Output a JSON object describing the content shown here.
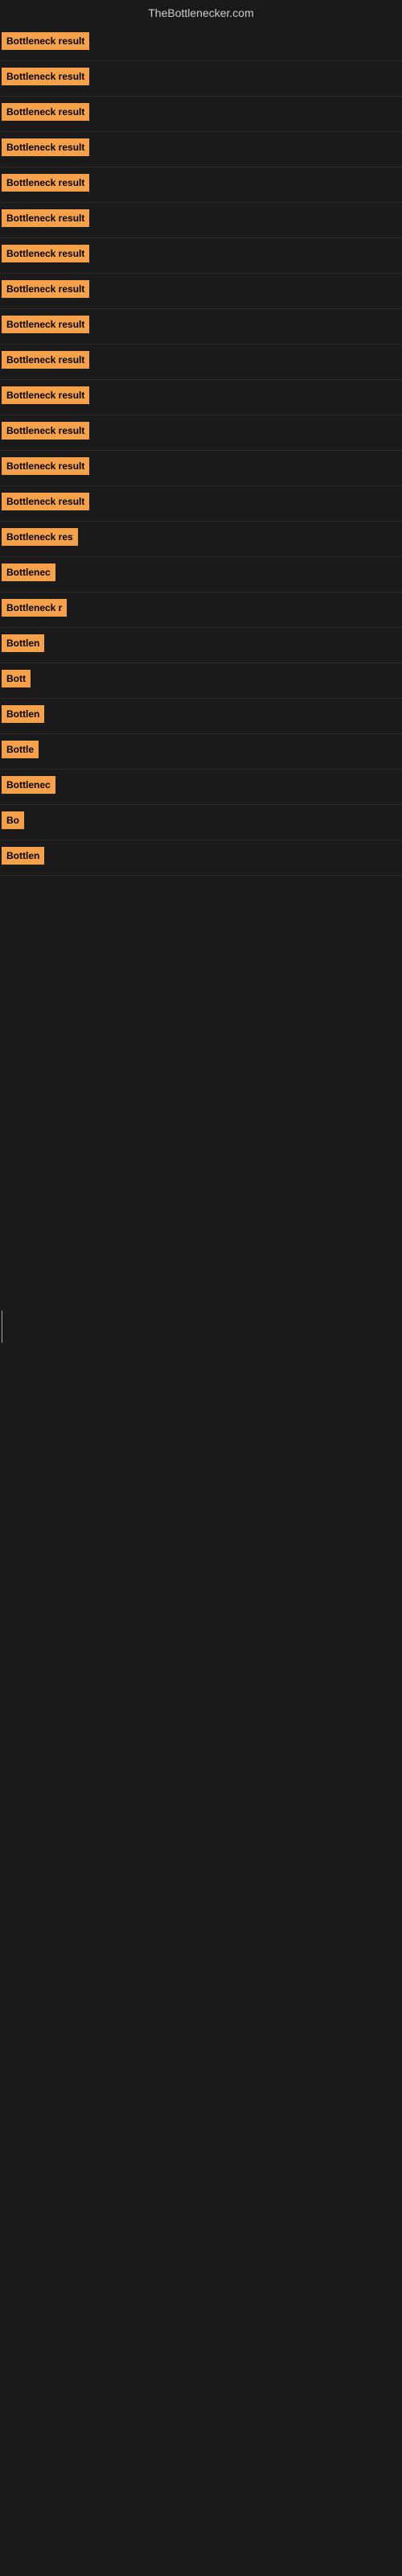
{
  "site": {
    "title": "TheBottlenecker.com"
  },
  "rows": [
    {
      "label": "Bottleneck result",
      "width": 120
    },
    {
      "label": "Bottleneck result",
      "width": 120
    },
    {
      "label": "Bottleneck result",
      "width": 120
    },
    {
      "label": "Bottleneck result",
      "width": 120
    },
    {
      "label": "Bottleneck result",
      "width": 120
    },
    {
      "label": "Bottleneck result",
      "width": 120
    },
    {
      "label": "Bottleneck result",
      "width": 120
    },
    {
      "label": "Bottleneck result",
      "width": 120
    },
    {
      "label": "Bottleneck result",
      "width": 120
    },
    {
      "label": "Bottleneck result",
      "width": 120
    },
    {
      "label": "Bottleneck result",
      "width": 120
    },
    {
      "label": "Bottleneck result",
      "width": 120
    },
    {
      "label": "Bottleneck result",
      "width": 120
    },
    {
      "label": "Bottleneck result",
      "width": 120
    },
    {
      "label": "Bottleneck res",
      "width": 100
    },
    {
      "label": "Bottlenec",
      "width": 72
    },
    {
      "label": "Bottleneck r",
      "width": 82
    },
    {
      "label": "Bottlen",
      "width": 60
    },
    {
      "label": "Bott",
      "width": 40
    },
    {
      "label": "Bottlen",
      "width": 60
    },
    {
      "label": "Bottle",
      "width": 52
    },
    {
      "label": "Bottlenec",
      "width": 72
    },
    {
      "label": "Bo",
      "width": 28
    },
    {
      "label": "Bottlen",
      "width": 60
    }
  ]
}
